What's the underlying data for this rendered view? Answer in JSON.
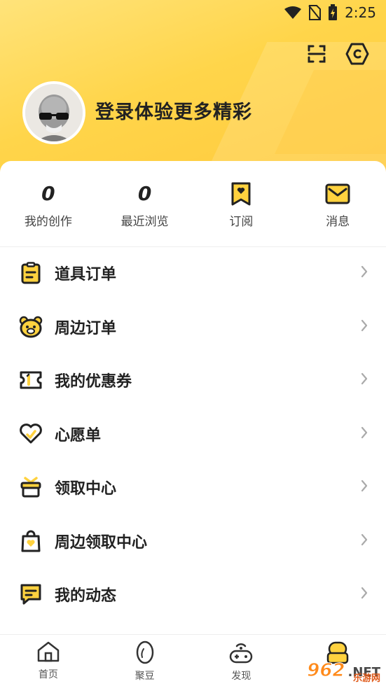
{
  "status_bar": {
    "time": "2:25"
  },
  "header": {
    "login_prompt": "登录体验更多精彩"
  },
  "stats": [
    {
      "value": "0",
      "label": "我的创作"
    },
    {
      "value": "0",
      "label": "最近浏览"
    },
    {
      "label": "订阅",
      "icon": "bookmark-heart-icon"
    },
    {
      "label": "消息",
      "icon": "mail-icon"
    }
  ],
  "menu": [
    {
      "label": "道具订单",
      "icon": "clipboard-icon"
    },
    {
      "label": "周边订单",
      "icon": "bear-icon"
    },
    {
      "label": "我的优惠券",
      "icon": "ticket-icon"
    },
    {
      "label": "心愿单",
      "icon": "heart-icon"
    },
    {
      "label": "领取中心",
      "icon": "gift-icon"
    },
    {
      "label": "周边领取中心",
      "icon": "bag-heart-icon"
    },
    {
      "label": "我的动态",
      "icon": "chat-icon"
    }
  ],
  "tabbar": [
    {
      "label": "首页",
      "icon": "home-icon"
    },
    {
      "label": "聚豆",
      "icon": "bean-icon"
    },
    {
      "label": "发现",
      "icon": "gamepad-icon"
    },
    {
      "label": "",
      "icon": "profile-icon"
    }
  ],
  "watermark": {
    "number": "962",
    "suffix": ".NET",
    "site": "乐游网"
  },
  "colors": {
    "accent": "#ffd54a",
    "icon_fill": "#ffd23f",
    "text": "#222222"
  }
}
